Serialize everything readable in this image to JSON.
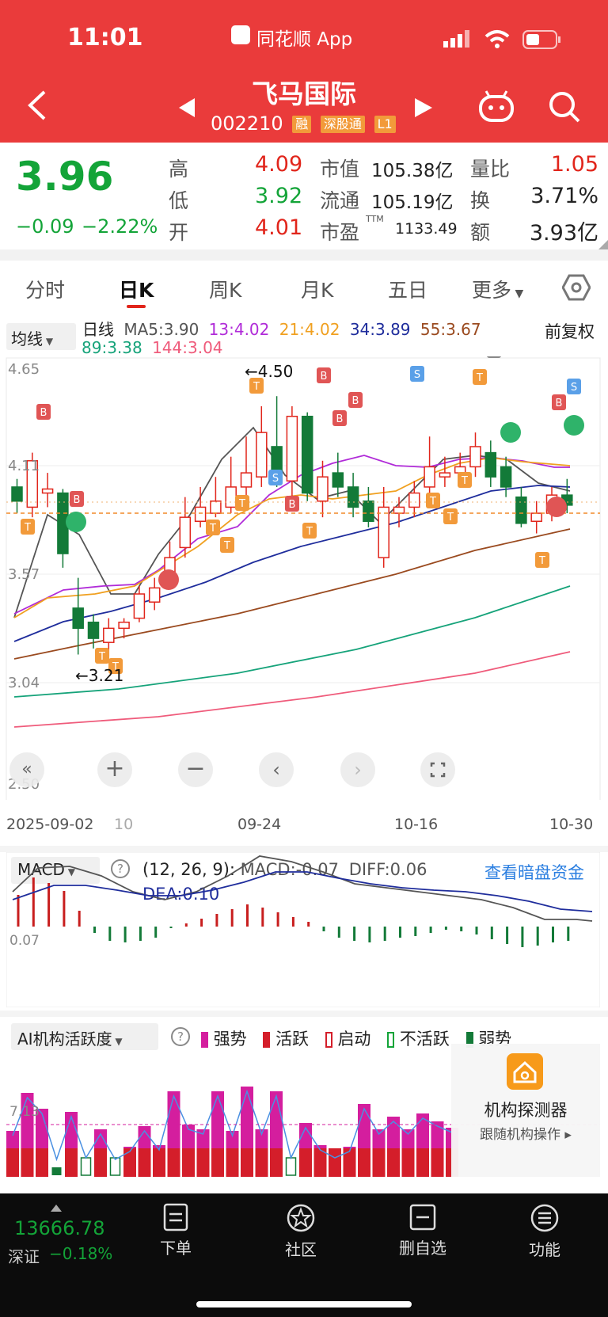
{
  "status": {
    "time": "11:01",
    "app_name": "同花顺 App"
  },
  "header": {
    "stock_name": "飞马国际",
    "stock_code": "002210",
    "badges": [
      "融",
      "深股通",
      "L1"
    ]
  },
  "quote": {
    "price": "3.96",
    "change": "−0.09",
    "change_pct": "−2.22%",
    "high_label": "高",
    "high": "4.09",
    "low_label": "低",
    "low": "3.92",
    "open_label": "开",
    "open": "4.01",
    "mkt_cap_label": "市值",
    "mkt_cap": "105.38亿",
    "float_label": "流通",
    "float_cap": "105.19亿",
    "pe_label": "市盈",
    "pe_sup": "TTM",
    "pe": "1133.49",
    "vol_ratio_label": "量比",
    "vol_ratio": "1.05",
    "turnover_label": "换",
    "turnover": "3.71%",
    "amount_label": "额",
    "amount": "3.93亿"
  },
  "tabs": [
    "分时",
    "日K",
    "周K",
    "月K",
    "五日",
    "更多"
  ],
  "active_tab": "日K",
  "ma_bar": {
    "selector": "均线",
    "period": "日线",
    "ma5": "MA5:3.90",
    "ma13": "13:4.02",
    "ma21": "21:4.02",
    "ma34": "34:3.89",
    "ma55": "55:3.67",
    "ma89": "89:3.38",
    "ma144": "144:3.04",
    "adjust": "前复权"
  },
  "kline": {
    "y_labels": [
      "4.65",
      "4.11",
      "3.57",
      "3.04",
      "2.50"
    ],
    "max_label": "←4.50",
    "min_label": "←3.21",
    "dates": [
      "2025-09-02",
      "10",
      "09-24",
      "10-16",
      "10-30"
    ]
  },
  "macd": {
    "selector": "MACD",
    "params": "(12, 26, 9):",
    "macd": "MACD:-0.07",
    "diff": "DIFF:0.06",
    "dea": "DEA:0.10",
    "link": "查看暗盘资金",
    "axis_label": "0.07"
  },
  "ai": {
    "selector": "AI机构活跃度",
    "legend": [
      "强势",
      "活跃",
      "启动",
      "不活跃",
      "弱势"
    ],
    "axis_label": "7.13",
    "detector_title": "机构探测器",
    "detector_sub": "跟随机构操作"
  },
  "bottom": {
    "index_value": "13666.78",
    "index_name": "深证",
    "index_change": "−0.18%",
    "nav": [
      "下单",
      "社区",
      "删自选",
      "功能"
    ]
  },
  "colors": {
    "header_red": "#ea3b3b",
    "up_red": "#e1251b",
    "down_green": "#13a438",
    "ma5": "#555555",
    "ma13": "#b02bd8",
    "ma21": "#f0a020",
    "ma34": "#1f2d9c",
    "ma55": "#9a4a1f",
    "ma89": "#16a37a",
    "ma144": "#ef5b7b"
  }
}
